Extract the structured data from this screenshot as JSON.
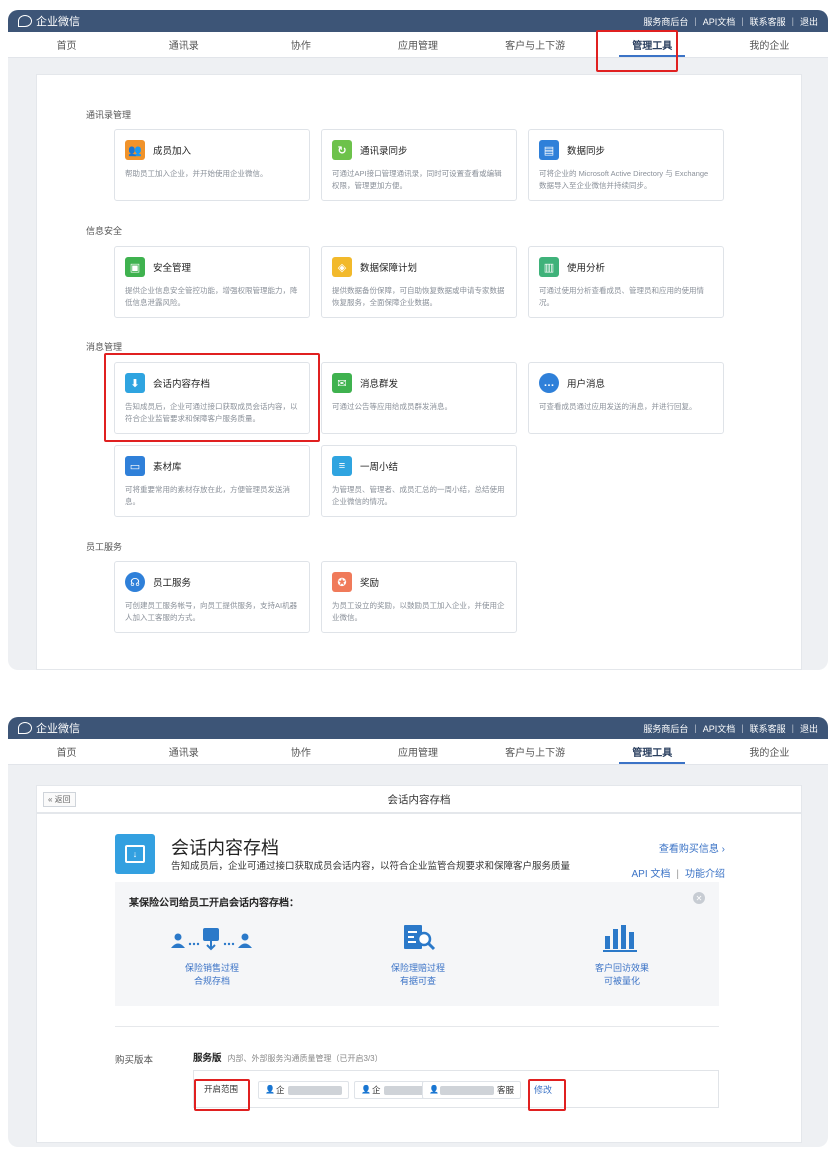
{
  "brand": "企业微信",
  "top_links": [
    "服务商后台",
    "API文档",
    "联系客服",
    "退出"
  ],
  "nav_tabs": [
    "首页",
    "通讯录",
    "协作",
    "应用管理",
    "客户与上下游",
    "管理工具",
    "我的企业"
  ],
  "active_tab": "管理工具",
  "sections": {
    "contacts": {
      "title": "通讯录管理",
      "cards": [
        {
          "title": "成员加入",
          "desc": "帮助员工加入企业，并开始使用企业微信。",
          "icon": "users-icon",
          "color": "#f0932b"
        },
        {
          "title": "通讯录同步",
          "desc": "可通过API接口管理通讯录，同时可设置查看或编辑权限，管理更加方便。",
          "icon": "sync-icon",
          "color": "#6dc24b"
        },
        {
          "title": "数据同步",
          "desc": "可将企业的 Microsoft Active Directory 与 Exchange 数据导入至企业微信并持续同步。",
          "icon": "database-icon",
          "color": "#2f80d9"
        }
      ]
    },
    "security": {
      "title": "信息安全",
      "cards": [
        {
          "title": "安全管理",
          "desc": "提供企业信息安全管控功能，增强权限管理能力，降低信息泄露风险。",
          "icon": "shield-icon",
          "color": "#3fb24f"
        },
        {
          "title": "数据保障计划",
          "desc": "提供数据备份保障，可自助恢复数据或申请专家数据恢复服务，全面保障企业数据。",
          "icon": "badge-icon",
          "color": "#f2b92b"
        },
        {
          "title": "使用分析",
          "desc": "可通过使用分析查看成员、管理员和应用的使用情况。",
          "icon": "bar-chart-icon",
          "color": "#3fb27a"
        }
      ]
    },
    "messaging": {
      "title": "消息管理",
      "cards": [
        {
          "title": "会话内容存档",
          "desc": "告知成员后，企业可通过接口获取成员会话内容，以符合企业监管要求和保障客户服务质量。",
          "icon": "archive-icon",
          "color": "#2fa4e0"
        },
        {
          "title": "消息群发",
          "desc": "可通过公告等应用给成员群发消息。",
          "icon": "message-icon",
          "color": "#3fb24f"
        },
        {
          "title": "用户消息",
          "desc": "可查看成员通过应用发送的消息，并进行回复。",
          "icon": "chat-icon",
          "color": "#2f80d9"
        },
        {
          "title": "素材库",
          "desc": "可将重要常用的素材存放在此，方便管理员发送消息。",
          "icon": "folder-icon",
          "color": "#2f80d9"
        },
        {
          "title": "一周小结",
          "desc": "为管理员、管理者、成员汇总的一周小结，总结使用企业微信的情况。",
          "icon": "report-icon",
          "color": "#2fa4e0"
        }
      ]
    },
    "staff": {
      "title": "员工服务",
      "cards": [
        {
          "title": "员工服务",
          "desc": "可创建员工服务帐号，向员工提供服务，支持AI机器人加入工客服的方式。",
          "icon": "headset-icon",
          "color": "#2f80d9"
        },
        {
          "title": "奖励",
          "desc": "为员工设立的奖励，以鼓励员工加入企业，并使用企业微信。",
          "icon": "award-icon",
          "color": "#f07a5a"
        }
      ]
    }
  },
  "detail": {
    "back_label": "« 返回",
    "page_title": "会话内容存档",
    "heading": "会话内容存档",
    "description": "告知成员后，企业可通过接口获取成员会话内容，以符合企业监管合规要求和保障客户服务质量",
    "view_purchase": "查看购买信息 ›",
    "api_doc": "API 文档",
    "feature_intro": "功能介绍",
    "promo_title": "某保险公司给员工开启会话内容存档：",
    "features": [
      {
        "line1": "保险销售过程",
        "line2": "合规存档",
        "icon": "transfer-icon"
      },
      {
        "line1": "保险理赔过程",
        "line2": "有据可查",
        "icon": "document-search-icon"
      },
      {
        "line1": "客户回访效果",
        "line2": "可被量化",
        "icon": "bar-chart-icon"
      }
    ],
    "buy_label": "购买版本",
    "plan_name": "服务版",
    "plan_sub": "内部、外部服务沟通质量管理（已开启3/3）",
    "scope_label": "开启范围",
    "members": [
      "企",
      "企",
      "客服"
    ],
    "edit_label": "修改"
  }
}
